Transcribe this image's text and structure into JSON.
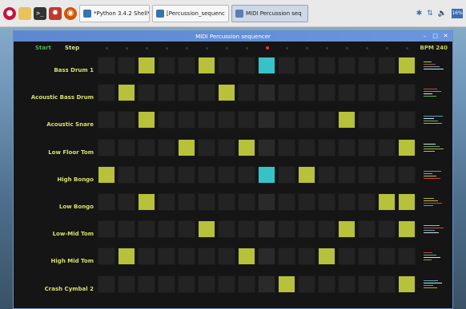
{
  "taskbar": {
    "tasks": [
      {
        "label": "*Python 3.4.2 Shell*",
        "active": false
      },
      {
        "label": "[Percussion_sequenc",
        "active": false
      },
      {
        "label": "MIDI Percussion seq",
        "active": true
      }
    ],
    "cpu": "16%"
  },
  "window": {
    "title": "MIDI Percussion sequencer"
  },
  "controls": {
    "start": "Start",
    "step": "Step",
    "bpm": "BPM 240"
  },
  "sequencer": {
    "current_step": 8,
    "colors": {
      "on": "#b7c139",
      "current_on": "#35c3c8",
      "indicator_active": "#ee3333"
    },
    "tracks": [
      {
        "name": "Bass Drum 1",
        "steps": [
          2,
          5,
          8,
          15
        ]
      },
      {
        "name": "Acoustic Bass Drum",
        "steps": [
          1,
          6
        ]
      },
      {
        "name": "Acoustic Snare",
        "steps": [
          2,
          12
        ]
      },
      {
        "name": "Low Floor Tom",
        "steps": [
          4,
          7,
          15
        ]
      },
      {
        "name": "High Bongo",
        "steps": [
          0,
          8,
          10
        ]
      },
      {
        "name": "Low Bongo",
        "steps": [
          2,
          14,
          15
        ]
      },
      {
        "name": "Low-Mid Tom",
        "steps": [
          5,
          12,
          15
        ]
      },
      {
        "name": "High Mid Tom",
        "steps": [
          1,
          7,
          11
        ]
      },
      {
        "name": "Crash Cymbal 2",
        "steps": [
          9,
          15
        ]
      }
    ]
  }
}
